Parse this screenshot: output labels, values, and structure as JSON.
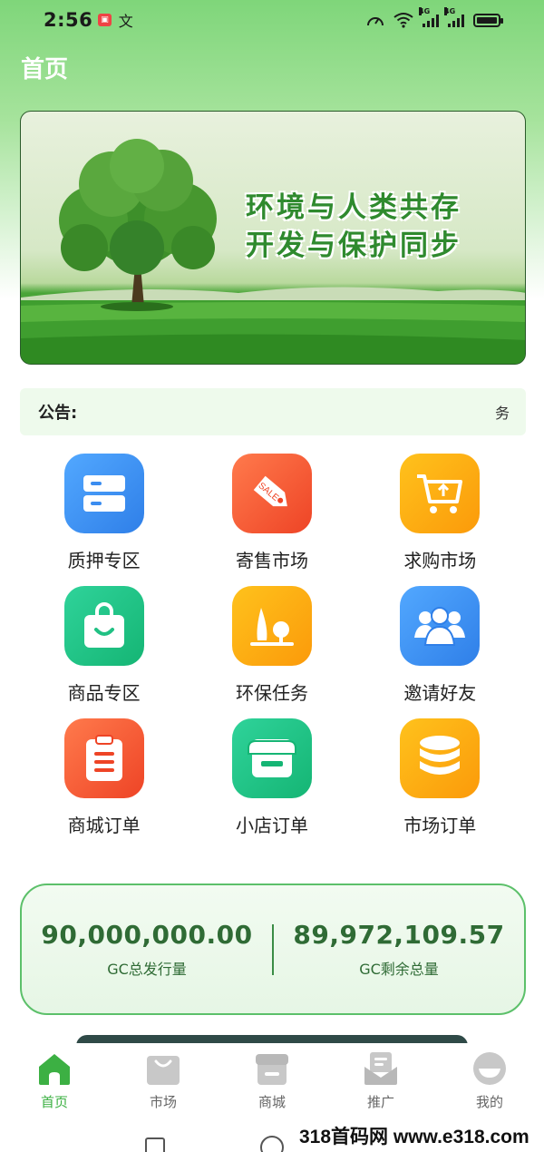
{
  "status_bar": {
    "time": "2:56",
    "network_label_1": "4G",
    "network_label_2": "4G"
  },
  "header": {
    "title": "首页"
  },
  "banner": {
    "line1": "环境与人类共存",
    "line2": "开发与保护同步"
  },
  "notice": {
    "label": "公告:",
    "scroll_text": "务"
  },
  "menu": [
    {
      "label": "质押专区",
      "icon": "storage-icon",
      "color": "#3b8df0"
    },
    {
      "label": "寄售市场",
      "icon": "sale-tag-icon",
      "color": "#f15a35"
    },
    {
      "label": "求购市场",
      "icon": "cart-upload-icon",
      "color": "#fba20c"
    },
    {
      "label": "商品专区",
      "icon": "shopping-bag-icon",
      "color": "#21c184"
    },
    {
      "label": "环保任务",
      "icon": "tree-icon",
      "color": "#fba20c"
    },
    {
      "label": "邀请好友",
      "icon": "users-icon",
      "color": "#3b8df0"
    },
    {
      "label": "商城订单",
      "icon": "clipboard-icon",
      "color": "#f15a35"
    },
    {
      "label": "小店订单",
      "icon": "shop-icon",
      "color": "#21c184"
    },
    {
      "label": "市场订单",
      "icon": "coins-icon",
      "color": "#fba20c"
    }
  ],
  "stats": {
    "total_issued_value": "90,000,000.00",
    "total_issued_label": "GC总发行量",
    "remaining_value": "89,972,109.57",
    "remaining_label": "GC剩余总量"
  },
  "tabbar": [
    {
      "label": "首页",
      "icon": "home-icon",
      "active": true
    },
    {
      "label": "市场",
      "icon": "bag-icon",
      "active": false
    },
    {
      "label": "商城",
      "icon": "store-icon",
      "active": false
    },
    {
      "label": "推广",
      "icon": "mail-icon",
      "active": false
    },
    {
      "label": "我的",
      "icon": "profile-icon",
      "active": false
    }
  ],
  "watermark": "318首码网 www.e318.com",
  "colors": {
    "accent": "#3cb043",
    "stat_text": "#2f6b35",
    "tab_inactive": "#666666"
  }
}
